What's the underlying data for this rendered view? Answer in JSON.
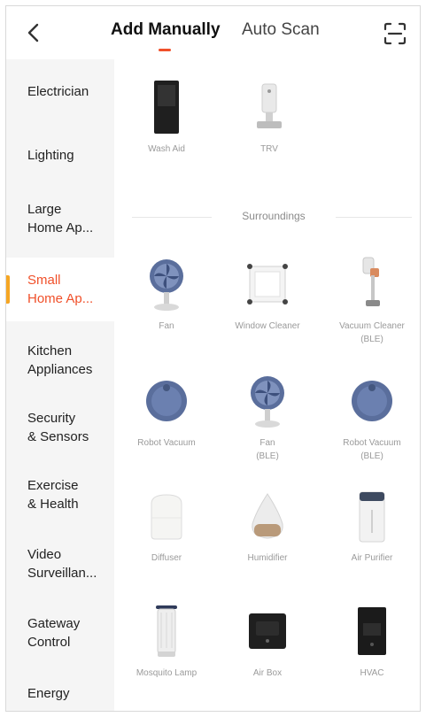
{
  "header": {
    "tabs": [
      {
        "label": "Add Manually",
        "active": true
      },
      {
        "label": "Auto Scan",
        "active": false
      }
    ],
    "accent_color": "#f0502a"
  },
  "sidebar": {
    "items": [
      {
        "label": "Electrician"
      },
      {
        "label": "Lighting"
      },
      {
        "label": "Large\nHome Ap..."
      },
      {
        "label": "Small\nHome Ap...",
        "active": true
      },
      {
        "label": "Kitchen\nAppliances"
      },
      {
        "label": "Security\n& Sensors"
      },
      {
        "label": "Exercise\n& Health"
      },
      {
        "label": "Video\nSurveillan..."
      },
      {
        "label": "Gateway\nControl"
      },
      {
        "label": "Energy"
      }
    ]
  },
  "content": {
    "top_devices": [
      {
        "label": "Wash Aid",
        "icon": "dark-panel-icon"
      },
      {
        "label": "TRV",
        "icon": "trv-valve-icon"
      }
    ],
    "section_title": "Surroundings",
    "devices": [
      {
        "label": "Fan",
        "icon": "fan-icon"
      },
      {
        "label": "Window Cleaner",
        "icon": "window-cleaner-icon"
      },
      {
        "label": "Vacuum Cleaner\n(BLE)",
        "icon": "stick-vacuum-icon"
      },
      {
        "label": "Robot Vacuum",
        "icon": "robot-vacuum-icon"
      },
      {
        "label": "Fan\n(BLE)",
        "icon": "fan-icon"
      },
      {
        "label": "Robot Vacuum\n(BLE)",
        "icon": "robot-vacuum-icon"
      },
      {
        "label": "Diffuser",
        "icon": "diffuser-icon"
      },
      {
        "label": "Humidifier",
        "icon": "humidifier-icon"
      },
      {
        "label": "Air Purifier",
        "icon": "air-purifier-icon"
      },
      {
        "label": "Mosquito Lamp",
        "icon": "mosquito-lamp-icon"
      },
      {
        "label": "Air Box",
        "icon": "air-box-icon"
      },
      {
        "label": "HVAC",
        "icon": "hvac-icon"
      }
    ]
  }
}
